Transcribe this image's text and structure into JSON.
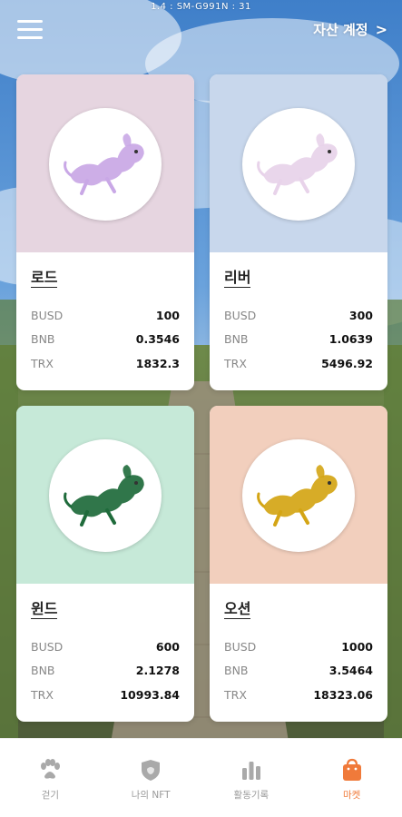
{
  "status_debug": "1.4 : SM-G991N : 31",
  "header": {
    "account_label": "자산 계정"
  },
  "cards": [
    {
      "name": "로드",
      "top_color": "#e6d5e0",
      "dog_color": "#c9a8e6",
      "rows": [
        {
          "label": "BUSD",
          "value": "100"
        },
        {
          "label": "BNB",
          "value": "0.3546"
        },
        {
          "label": "TRX",
          "value": "1832.3"
        }
      ]
    },
    {
      "name": "리버",
      "top_color": "#c8d7ec",
      "dog_color": "#e8d3ea",
      "rows": [
        {
          "label": "BUSD",
          "value": "300"
        },
        {
          "label": "BNB",
          "value": "1.0639"
        },
        {
          "label": "TRX",
          "value": "5496.92"
        }
      ]
    },
    {
      "name": "윈드",
      "top_color": "#c6e9d8",
      "dog_color": "#1f6b3b",
      "rows": [
        {
          "label": "BUSD",
          "value": "600"
        },
        {
          "label": "BNB",
          "value": "2.1278"
        },
        {
          "label": "TRX",
          "value": "10993.84"
        }
      ]
    },
    {
      "name": "오션",
      "top_color": "#f2cfbd",
      "dog_color": "#d4a515",
      "rows": [
        {
          "label": "BUSD",
          "value": "1000"
        },
        {
          "label": "BNB",
          "value": "3.5464"
        },
        {
          "label": "TRX",
          "value": "18323.06"
        }
      ]
    }
  ],
  "tabs": [
    {
      "label": "걷기",
      "icon": "paw-icon",
      "active": false
    },
    {
      "label": "나의 NFT",
      "icon": "shield-icon",
      "active": false
    },
    {
      "label": "활동기록",
      "icon": "bar-chart-icon",
      "active": false
    },
    {
      "label": "마켓",
      "icon": "shopping-bag-icon",
      "active": true
    }
  ],
  "colors": {
    "accent": "#f07a3a",
    "inactive": "#9a9a9a"
  }
}
